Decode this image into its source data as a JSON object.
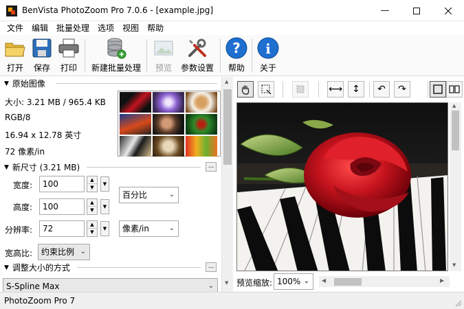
{
  "window": {
    "title": "BenVista PhotoZoom Pro 7.0.6 - [example.jpg]",
    "minimize_icon": "minimize-icon",
    "maximize_icon": "maximize-icon",
    "close_icon": "close-icon"
  },
  "menu": [
    "文件",
    "编辑",
    "批量处理",
    "选项",
    "视图",
    "帮助"
  ],
  "toolbar": {
    "open": "打开",
    "save": "保存",
    "print": "打印",
    "new_batch": "新建批量处理",
    "preview": "预览",
    "settings": "参数设置",
    "help": "帮助",
    "about": "关于"
  },
  "original_image": {
    "header": "原始图像",
    "size": "大小: 3.21 MB / 965.4 KB",
    "mode": "RGB/8",
    "dimensions": "16.94 x 12.78 英寸",
    "resolution": "72 像素/in"
  },
  "new_size": {
    "header": "新尺寸 (3.21 MB)",
    "width_label": "宽度:",
    "width_value": "100",
    "height_label": "高度:",
    "height_value": "100",
    "resolution_label": "分辨率:",
    "resolution_value": "72",
    "unit_percent": "百分比",
    "unit_resolution": "像素/in",
    "aspect_label": "宽高比:",
    "aspect_value": "约束比例"
  },
  "resize_method": {
    "header": "调整大小的方式",
    "value": "S-Spline Max"
  },
  "preview_panel": {
    "zoom_label": "预览缩放:",
    "zoom_value": "100%"
  },
  "statusbar": {
    "text": "PhotoZoom Pro 7"
  },
  "colors": {
    "accent_blue": "#1e6fd0",
    "rose_red": "#c8141e"
  }
}
